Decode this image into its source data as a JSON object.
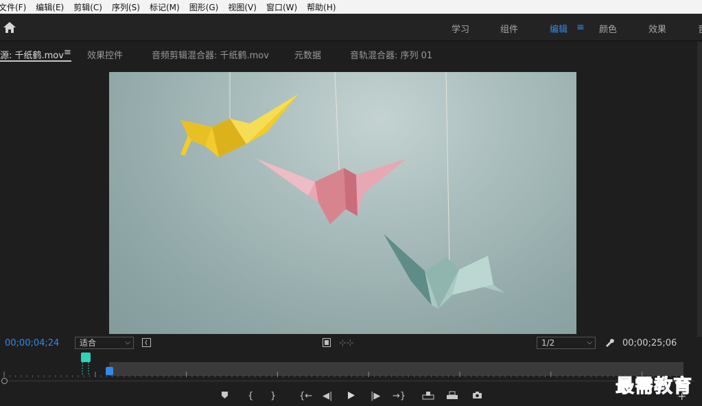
{
  "menu": {
    "items": [
      "文件(F)",
      "编辑(E)",
      "剪辑(C)",
      "序列(S)",
      "标记(M)",
      "图形(G)",
      "视图(V)",
      "窗口(W)",
      "帮助(H)"
    ]
  },
  "workspace": {
    "home_icon": "home-icon",
    "tabs": [
      "学习",
      "组件",
      "编辑",
      "颜色",
      "效果",
      "音"
    ],
    "active_tab": "编辑",
    "accent": "#2d8ceb"
  },
  "panels": {
    "tabs": [
      "源: 千纸鹤.mov",
      "效果控件",
      "音频剪辑混合器: 千纸鹤.mov",
      "元数据",
      "音轨混合器: 序列 01"
    ],
    "active_tab": "源: 千纸鹤.mov"
  },
  "source_monitor": {
    "current_timecode": "00;00;04;24",
    "duration_timecode": "00;00;25;06",
    "zoom_select": "适合",
    "resolution_select": "1/2",
    "timecode_color": "#2d8ceb"
  },
  "transport": {
    "buttons": [
      "add-marker",
      "mark-in",
      "mark-out",
      "go-to-in",
      "step-back",
      "play",
      "step-forward",
      "go-to-out",
      "insert",
      "overwrite",
      "export-frame",
      "add-button"
    ]
  },
  "watermark": {
    "text": "最需教育",
    "color": "#1c3cb8"
  }
}
